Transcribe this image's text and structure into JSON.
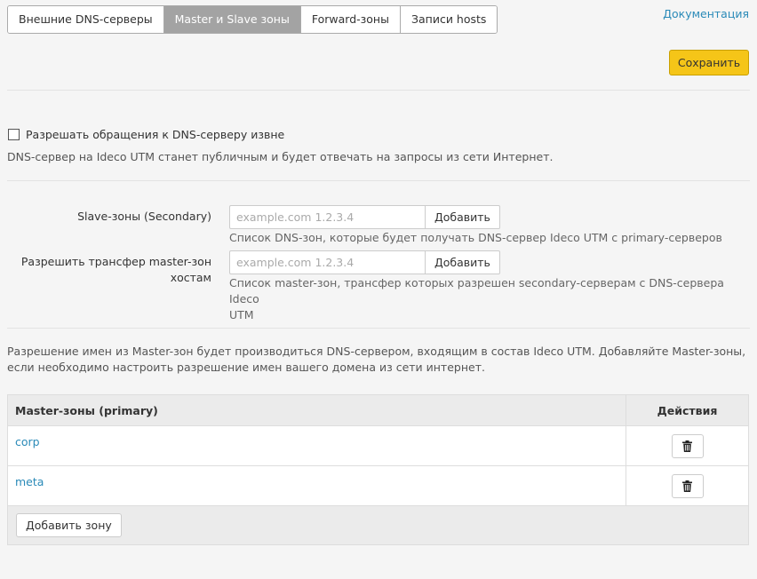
{
  "tabs": [
    {
      "label": "Внешние DNS-серверы",
      "active": false
    },
    {
      "label": "Master и Slave зоны",
      "active": true
    },
    {
      "label": "Forward-зоны",
      "active": false
    },
    {
      "label": "Записи hosts",
      "active": false
    }
  ],
  "header": {
    "doc_link": "Документация",
    "save_label": "Сохранить"
  },
  "external_access": {
    "checkbox_label": "Разрешать обращения к DNS-серверу извне",
    "checked": false,
    "help": "DNS-сервер на Ideco UTM станет публичным и будет отвечать на запросы из сети Интернет."
  },
  "slave_zones": {
    "label": "Slave-зоны (Secondary)",
    "placeholder": "example.com 1.2.3.4",
    "value": "",
    "button": "Добавить",
    "help": "Список DNS-зон, которые будет получать DNS-сервер Ideco UTM с primary-серверов"
  },
  "transfer": {
    "label_line1": "Разрешить трансфер master-зон",
    "label_line2": "хостам",
    "placeholder": "example.com 1.2.3.4",
    "value": "",
    "button": "Добавить",
    "help_line1": "Список master-зон, трансфер которых разрешен secondary-серверам с DNS-сервера Ideco",
    "help_line2": "UTM"
  },
  "master_info": "Разрешение имен из Master-зон будет производиться DNS-сервером, входящим в состав Ideco UTM. Добавляйте Master-зоны, если необходимо настроить разрешение имен вашего домена из сети интернет.",
  "master_table": {
    "col_name": "Master-зоны (primary)",
    "col_actions": "Действия",
    "rows": [
      {
        "name": "corp",
        "action_icon": "trash-icon"
      },
      {
        "name": "meta",
        "action_icon": "trash-icon"
      }
    ],
    "add_button": "Добавить зону"
  },
  "colors": {
    "accent_link": "#2a8ab8",
    "save_button": "#f5c518",
    "active_tab": "#a3a3a3"
  }
}
